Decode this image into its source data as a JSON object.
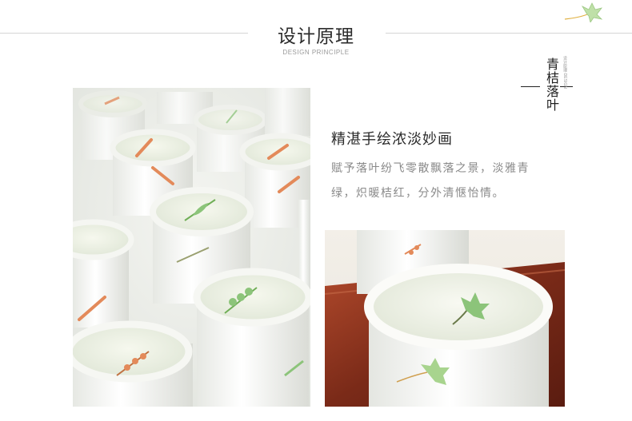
{
  "header": {
    "title": "设计原理",
    "subtitle": "DESIGN PRINCIPLE"
  },
  "brand": {
    "name_vertical": "青桔落叶",
    "fine_print": "设计原理·DESIGN"
  },
  "section": {
    "heading": "精湛手绘浓淡妙画",
    "body_lines": [
      "赋予落叶纷飞零散飘落之景，淡雅青",
      "绿，炽暖桔红，分外清惬怡情。"
    ]
  },
  "images": {
    "left_photo": "cups-grid-photo",
    "right_photo": "cup-closeup-photo"
  },
  "colors": {
    "rule": "#d6d6d6",
    "title": "#2b2b2b",
    "body": "#8a8a8a",
    "leaf_green": "#8cc47a",
    "leaf_orange": "#e38a5a",
    "tray": "#9a3a22"
  }
}
